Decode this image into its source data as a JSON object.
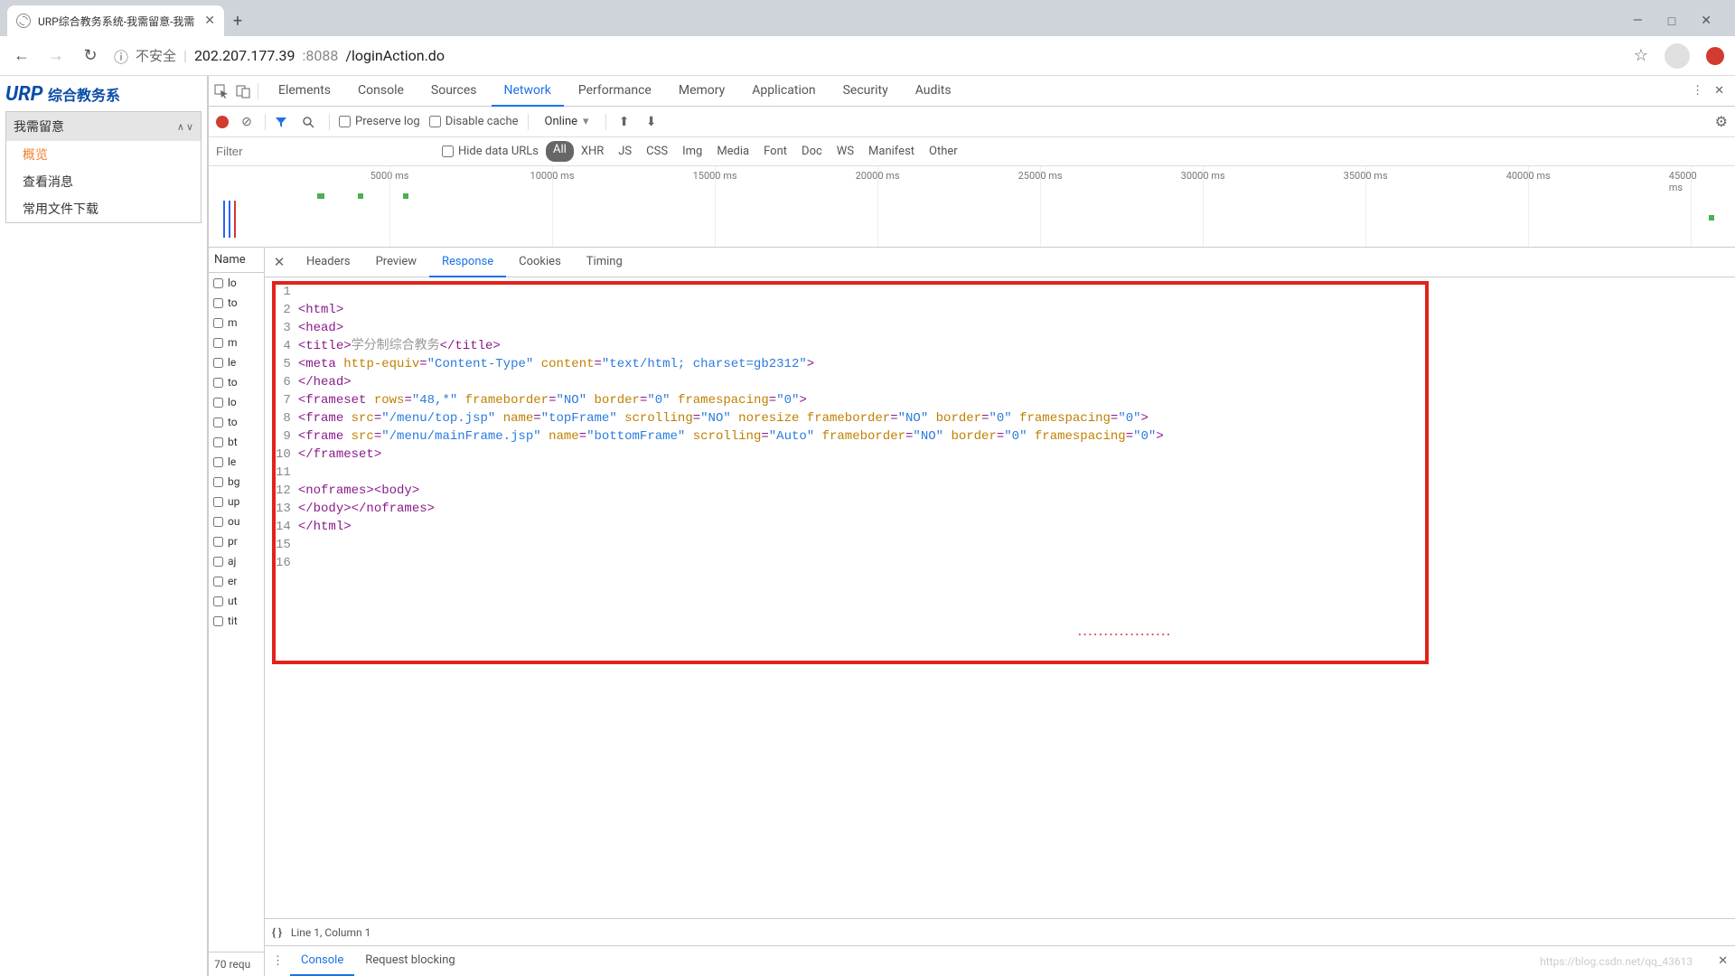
{
  "browser": {
    "tab_title": "URP综合教务系统-我需留意-我需",
    "new_tab": "+",
    "win": {
      "min": "—",
      "max": "□",
      "close": "✕"
    },
    "back": "←",
    "forward": "→",
    "reload": "↻",
    "insecure_icon": "ⓘ",
    "insecure_text": "不安全",
    "url_host": "202.207.177.39",
    "url_port": ":8088",
    "url_path": "/loginAction.do",
    "star": "☆"
  },
  "page": {
    "logo_en": "URP",
    "logo_cn": "综合教务系",
    "panel_title": "我需留意",
    "items": [
      "概览",
      "查看消息",
      "常用文件下载"
    ],
    "active_index": 0
  },
  "devtools": {
    "tabs": [
      "Elements",
      "Console",
      "Sources",
      "Network",
      "Performance",
      "Memory",
      "Application",
      "Security",
      "Audits"
    ],
    "active_tab": 3,
    "toolbar": {
      "preserve": "Preserve log",
      "disable": "Disable cache",
      "online": "Online"
    },
    "filter_placeholder": "Filter",
    "hide_urls": "Hide data URLs",
    "type_filters": [
      "All",
      "XHR",
      "JS",
      "CSS",
      "Img",
      "Media",
      "Font",
      "Doc",
      "WS",
      "Manifest",
      "Other"
    ],
    "type_active": 0,
    "timeline": [
      "5000 ms",
      "10000 ms",
      "15000 ms",
      "20000 ms",
      "25000 ms",
      "30000 ms",
      "35000 ms",
      "40000 ms",
      "45000 ms"
    ],
    "name_header": "Name",
    "requests": [
      "lo",
      "to",
      "m",
      "m",
      "le",
      "to",
      "lo",
      "to",
      "bt",
      "le",
      "bg",
      "up",
      "ou",
      "pr",
      "aj",
      "er",
      "ut",
      "tit"
    ],
    "req_footer": "70 requ",
    "detail_tabs": [
      "Headers",
      "Preview",
      "Response",
      "Cookies",
      "Timing"
    ],
    "detail_active": 2,
    "status_line": "Line 1, Column 1",
    "drawer_tabs": [
      "Console",
      "Request blocking"
    ],
    "drawer_active": 0,
    "watermark": "https://blog.csdn.net/qq_43613"
  },
  "code": {
    "lines": [
      {
        "n": 1,
        "seg": []
      },
      {
        "n": 2,
        "seg": [
          {
            "c": "t-tag",
            "t": "<html>"
          }
        ]
      },
      {
        "n": 3,
        "seg": [
          {
            "c": "t-tag",
            "t": "<head>"
          }
        ]
      },
      {
        "n": 4,
        "seg": [
          {
            "c": "t-tag",
            "t": "<title>"
          },
          {
            "c": "t-cn",
            "t": "学分制综合教务"
          },
          {
            "c": "t-tag",
            "t": "</title>"
          }
        ]
      },
      {
        "n": 5,
        "seg": [
          {
            "c": "t-tag",
            "t": "<meta "
          },
          {
            "c": "t-attr",
            "t": "http-equiv"
          },
          {
            "c": "t-tag",
            "t": "="
          },
          {
            "c": "t-str",
            "t": "\"Content-Type\""
          },
          {
            "c": "t-tag",
            "t": " "
          },
          {
            "c": "t-attr",
            "t": "content"
          },
          {
            "c": "t-tag",
            "t": "="
          },
          {
            "c": "t-str",
            "t": "\"text/html; charset=gb2312\""
          },
          {
            "c": "t-tag",
            "t": ">"
          }
        ]
      },
      {
        "n": 6,
        "seg": [
          {
            "c": "t-tag",
            "t": "</head>"
          }
        ]
      },
      {
        "n": 7,
        "seg": [
          {
            "c": "t-tag",
            "t": "<frameset "
          },
          {
            "c": "t-attr",
            "t": "rows"
          },
          {
            "c": "t-tag",
            "t": "="
          },
          {
            "c": "t-str",
            "t": "\"48,*\""
          },
          {
            "c": "t-tag",
            "t": " "
          },
          {
            "c": "t-attr",
            "t": "frameborder"
          },
          {
            "c": "t-tag",
            "t": "="
          },
          {
            "c": "t-str",
            "t": "\"NO\""
          },
          {
            "c": "t-tag",
            "t": " "
          },
          {
            "c": "t-attr",
            "t": "border"
          },
          {
            "c": "t-tag",
            "t": "="
          },
          {
            "c": "t-str",
            "t": "\"0\""
          },
          {
            "c": "t-tag",
            "t": " "
          },
          {
            "c": "t-attr",
            "t": "framespacing"
          },
          {
            "c": "t-tag",
            "t": "="
          },
          {
            "c": "t-str",
            "t": "\"0\""
          },
          {
            "c": "t-tag",
            "t": ">"
          }
        ]
      },
      {
        "n": 8,
        "seg": [
          {
            "c": "t-tag",
            "t": "<frame "
          },
          {
            "c": "t-attr",
            "t": "src"
          },
          {
            "c": "t-tag",
            "t": "="
          },
          {
            "c": "t-str",
            "t": "\"/menu/top.jsp\""
          },
          {
            "c": "t-tag",
            "t": " "
          },
          {
            "c": "t-attr",
            "t": "name"
          },
          {
            "c": "t-tag",
            "t": "="
          },
          {
            "c": "t-str",
            "t": "\"topFrame\""
          },
          {
            "c": "t-tag",
            "t": " "
          },
          {
            "c": "t-attr",
            "t": "scrolling"
          },
          {
            "c": "t-tag",
            "t": "="
          },
          {
            "c": "t-str",
            "t": "\"NO\""
          },
          {
            "c": "t-tag",
            "t": " "
          },
          {
            "c": "t-attr",
            "t": "noresize "
          },
          {
            "c": "t-attr",
            "t": "frameborder"
          },
          {
            "c": "t-tag",
            "t": "="
          },
          {
            "c": "t-str",
            "t": "\"NO\""
          },
          {
            "c": "t-tag",
            "t": " "
          },
          {
            "c": "t-attr",
            "t": "border"
          },
          {
            "c": "t-tag",
            "t": "="
          },
          {
            "c": "t-str",
            "t": "\"0\""
          },
          {
            "c": "t-tag",
            "t": " "
          },
          {
            "c": "t-attr",
            "t": "framespacing"
          },
          {
            "c": "t-tag",
            "t": "="
          },
          {
            "c": "t-str",
            "t": "\"0\""
          },
          {
            "c": "t-tag",
            "t": ">"
          }
        ]
      },
      {
        "n": 9,
        "seg": [
          {
            "c": "t-tag",
            "t": "<frame "
          },
          {
            "c": "t-attr",
            "t": "src"
          },
          {
            "c": "t-tag",
            "t": "="
          },
          {
            "c": "t-str",
            "t": "\"/menu/mainFrame.jsp\""
          },
          {
            "c": "t-tag",
            "t": " "
          },
          {
            "c": "t-attr",
            "t": "name"
          },
          {
            "c": "t-tag",
            "t": "="
          },
          {
            "c": "t-str",
            "t": "\"bottomFrame\""
          },
          {
            "c": "t-tag",
            "t": " "
          },
          {
            "c": "t-attr",
            "t": "scrolling"
          },
          {
            "c": "t-tag",
            "t": "="
          },
          {
            "c": "t-str",
            "t": "\"Auto\""
          },
          {
            "c": "t-tag",
            "t": " "
          },
          {
            "c": "t-attr",
            "t": "frameborder"
          },
          {
            "c": "t-tag",
            "t": "="
          },
          {
            "c": "t-str",
            "t": "\"NO\""
          },
          {
            "c": "t-tag",
            "t": " "
          },
          {
            "c": "t-attr",
            "t": "border"
          },
          {
            "c": "t-tag",
            "t": "="
          },
          {
            "c": "t-str",
            "t": "\"0\""
          },
          {
            "c": "t-tag",
            "t": " "
          },
          {
            "c": "t-attr",
            "t": "framespacing"
          },
          {
            "c": "t-tag",
            "t": "="
          },
          {
            "c": "t-str",
            "t": "\"0\""
          },
          {
            "c": "t-tag",
            "t": ">"
          }
        ]
      },
      {
        "n": 10,
        "seg": [
          {
            "c": "t-tag",
            "t": "</frameset>"
          }
        ]
      },
      {
        "n": 11,
        "seg": []
      },
      {
        "n": 12,
        "seg": [
          {
            "c": "t-tag",
            "t": "<noframes><body>"
          }
        ]
      },
      {
        "n": 13,
        "seg": [
          {
            "c": "t-tag",
            "t": "</body></noframes>"
          }
        ]
      },
      {
        "n": 14,
        "seg": [
          {
            "c": "t-tag",
            "t": "</html>"
          }
        ]
      },
      {
        "n": 15,
        "seg": []
      },
      {
        "n": 16,
        "seg": []
      }
    ]
  }
}
